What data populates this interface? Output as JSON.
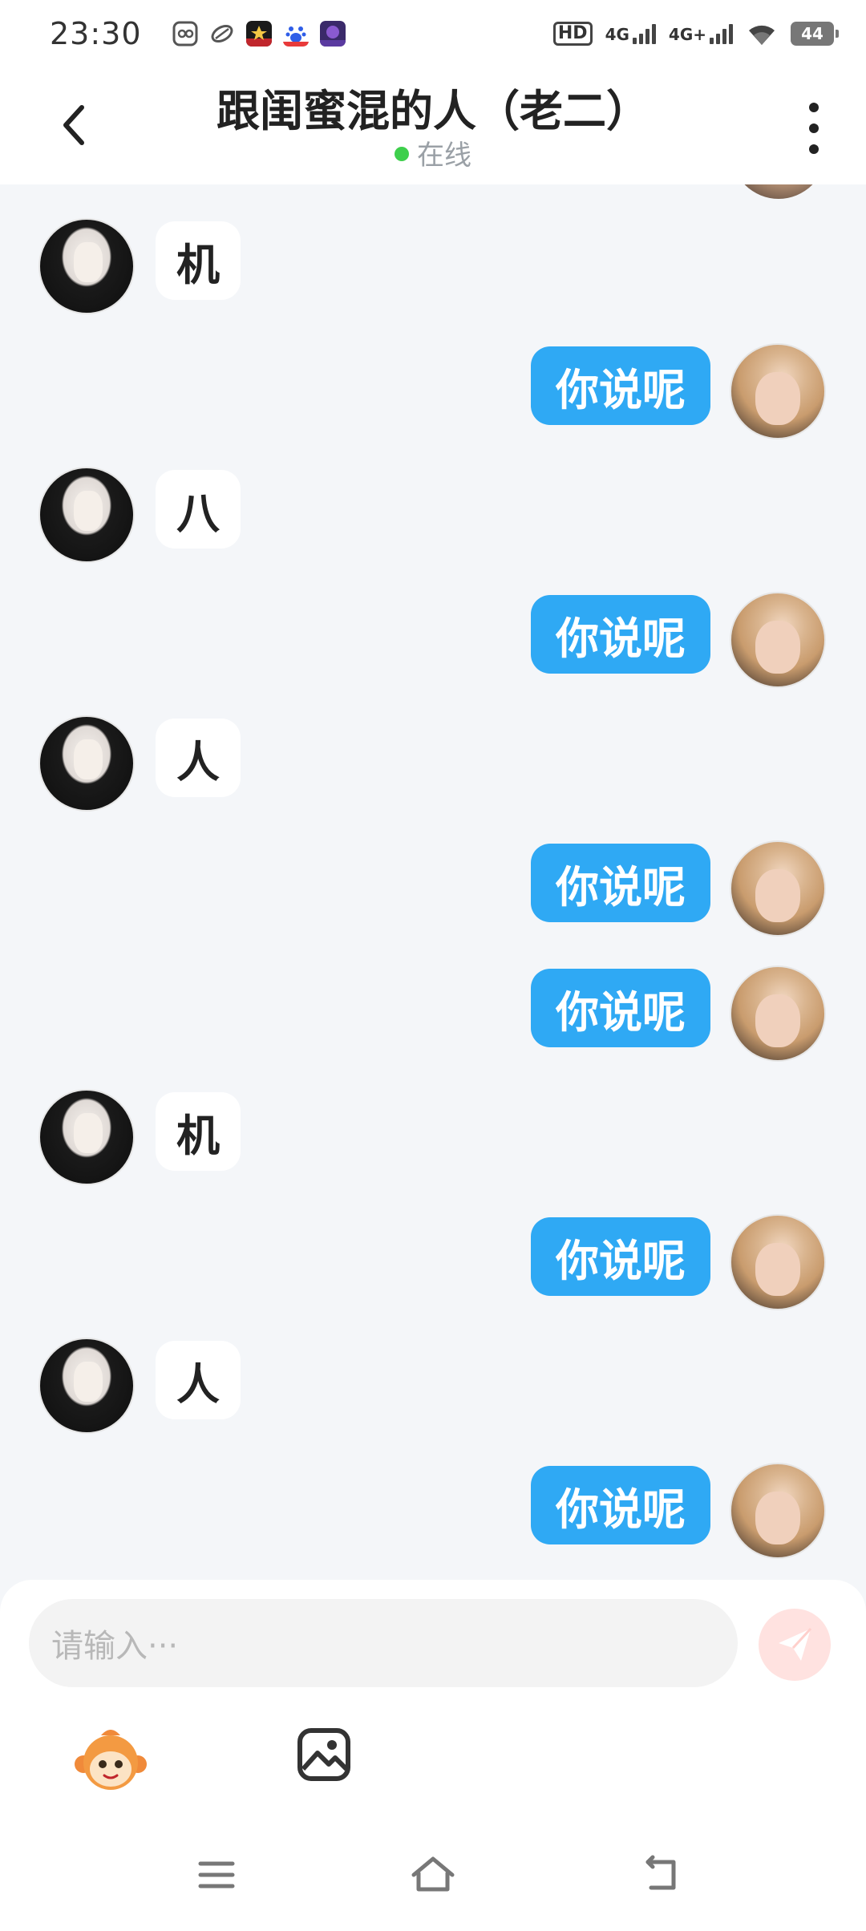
{
  "status_bar": {
    "time": "23:30",
    "network_hd": "HD",
    "signal_1": "4G",
    "signal_2": "4G+",
    "battery": "44",
    "app_icons": [
      "vpn-app-icon",
      "rocket-app-icon",
      "game-app-icon",
      "baidu-app-icon",
      "hero-game-app-icon"
    ]
  },
  "header": {
    "back_icon": "chevron-left-icon",
    "title": "跟闺蜜混的人（老二）",
    "status_text": "在线",
    "menu_icon": "more-vertical-icon"
  },
  "messages": [
    {
      "side": "left",
      "text": "机"
    },
    {
      "side": "right",
      "text": "你说呢"
    },
    {
      "side": "left",
      "text": "八"
    },
    {
      "side": "right",
      "text": "你说呢"
    },
    {
      "side": "left",
      "text": "人"
    },
    {
      "side": "right",
      "text": "你说呢"
    },
    {
      "side": "right",
      "text": "你说呢"
    },
    {
      "side": "left",
      "text": "机"
    },
    {
      "side": "right",
      "text": "你说呢"
    },
    {
      "side": "left",
      "text": "人"
    },
    {
      "side": "right",
      "text": "你说呢"
    }
  ],
  "composer": {
    "placeholder": "请输入···",
    "send_icon": "send-icon",
    "emoji_icon": "monkey-emoji-icon",
    "image_icon": "image-icon"
  },
  "nav_bar": {
    "icons": [
      "menu-icon",
      "home-icon",
      "back-icon"
    ]
  },
  "colors": {
    "accent": "#2fa9f4",
    "online": "#3ecf4c",
    "background": "#f4f6f9"
  }
}
